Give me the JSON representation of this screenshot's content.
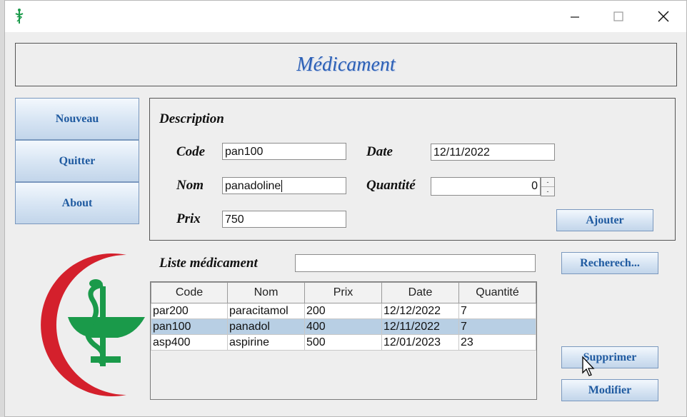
{
  "window": {
    "title": "",
    "controls": [
      "minimize-icon",
      "maximize-icon",
      "close-icon"
    ]
  },
  "header": {
    "title": "Médicament"
  },
  "nav": {
    "nouveau": "Nouveau",
    "quitter": "Quitter",
    "about": "About"
  },
  "description": {
    "title": "Description",
    "code_label": "Code",
    "code_value": "pan100",
    "date_label": "Date",
    "date_value": "12/11/2022",
    "nom_label": "Nom",
    "nom_value": "panadoline",
    "quantite_label": "Quantité",
    "quantite_value": "0",
    "prix_label": "Prix",
    "prix_value": "750",
    "ajouter": "Ajouter"
  },
  "list": {
    "title": "Liste médicament",
    "search_value": "",
    "search_button": "Recherech...",
    "columns": [
      "Code",
      "Nom",
      "Prix",
      "Date",
      "Quantité"
    ],
    "rows": [
      [
        "par200",
        "paracitamol",
        "200",
        "12/12/2022",
        "7"
      ],
      [
        "pan100",
        "panadol",
        "400",
        "12/11/2022",
        "7"
      ],
      [
        "asp400",
        "aspirine",
        "500",
        "12/01/2023",
        "23"
      ]
    ],
    "selected_row": 1
  },
  "actions": {
    "supprimer": "Supprimer",
    "modifier": "Modifier"
  },
  "colors": {
    "accent": "#2b5fb5",
    "button_text": "#1f5aa0",
    "selection": "#b8cfe4",
    "crescent": "#d4202c",
    "caduceus": "#1a9a4a"
  },
  "icons": [
    "pharmacy-app-icon",
    "red-crescent-logo",
    "caduceus-icon",
    "mouse-pointer-icon"
  ]
}
